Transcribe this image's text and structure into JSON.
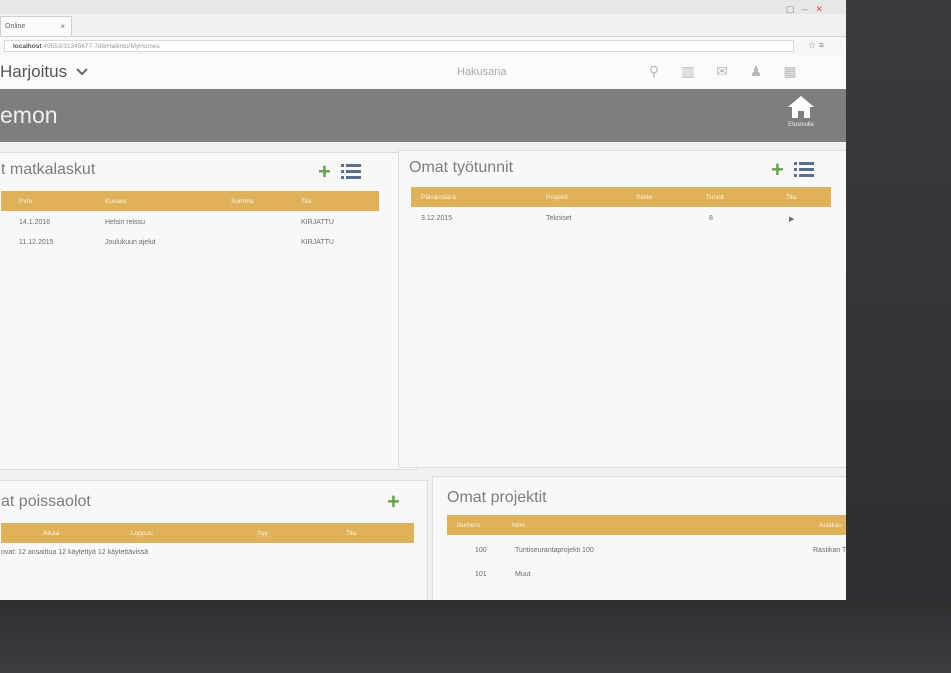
{
  "browser": {
    "tab_title": "Online",
    "url_host": "localhost",
    "url_path": ":49553/31345677-7d8/Hallinto/MyHomes",
    "window_controls": [
      "▢",
      "–",
      "✕"
    ]
  },
  "header": {
    "company": "Harjoitus",
    "search_label": "Hakusana",
    "icons": [
      "search-icon",
      "chart-icon",
      "mail-icon",
      "user-icon",
      "grid-icon"
    ]
  },
  "page": {
    "title": "emon",
    "home_label": "Etusivulle"
  },
  "panels": {
    "travel": {
      "title": "t matkalaskut",
      "columns": [
        "Pvm",
        "Kuvaus",
        "Summa",
        "Tila"
      ],
      "rows": [
        {
          "date": "14.1.2016",
          "desc": "Helsin reissu",
          "status": "KIRJATTU"
        },
        {
          "date": "11.12.2015",
          "desc": "Joulukuun ajelut",
          "status": "KIRJATTU"
        }
      ]
    },
    "hours": {
      "title": "Omat työtunnit",
      "columns": [
        "Päivämäärä",
        "Projekti",
        "Selite",
        "Tunnit",
        "Tila"
      ],
      "rows": [
        {
          "date": "3.12.2015",
          "project": "Tekniset",
          "hours": "8",
          "status": "▶"
        }
      ]
    },
    "absences": {
      "title": "at poissaolot",
      "columns": [
        "Alkaa",
        "Loppuu",
        "Syy",
        "Tila"
      ],
      "summary": "ovat: 12 ansaittua 12 käytettyä 12 käytettävissä"
    },
    "projects": {
      "title": "Omat projektit",
      "columns": [
        "Numero",
        "Nimi",
        "Asiakas"
      ],
      "rows": [
        {
          "number": "100",
          "name": "Tuntiseurantaprojekti 100",
          "customer": "Rastikan Turku Oy"
        },
        {
          "number": "101",
          "name": "Muut",
          "customer": ""
        }
      ]
    }
  }
}
